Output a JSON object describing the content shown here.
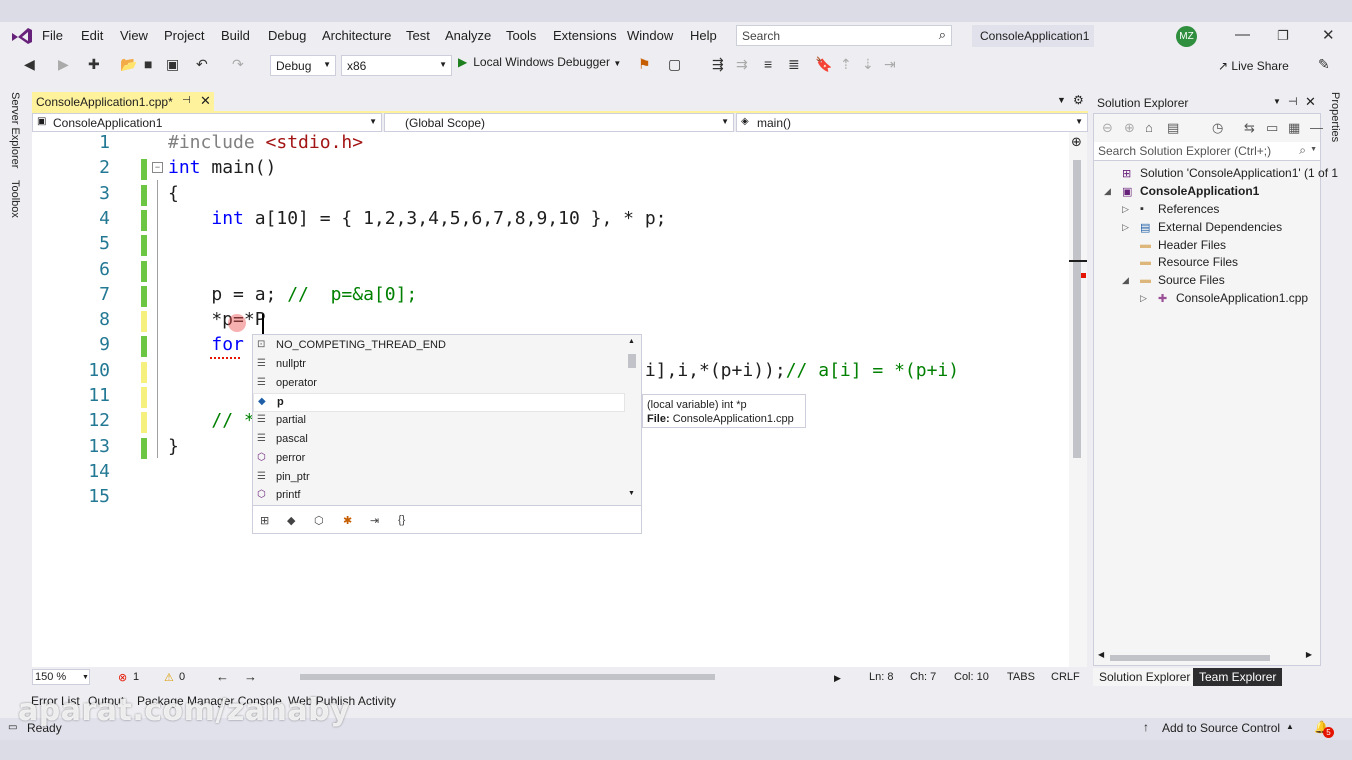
{
  "menu": {
    "items": [
      "File",
      "Edit",
      "View",
      "Project",
      "Build",
      "Debug",
      "Architecture",
      "Test",
      "Analyze",
      "Tools",
      "Extensions",
      "Window",
      "Help"
    ],
    "search_placeholder": "Search",
    "solution_name": "ConsoleApplication1",
    "avatar_initials": "MZ"
  },
  "toolbar": {
    "configuration": "Debug",
    "platform": "x86",
    "run_label": "Local Windows Debugger",
    "live_share": "Live Share"
  },
  "left_strip": {
    "server_explorer": "Server Explorer",
    "toolbox": "Toolbox"
  },
  "right_strip": {
    "properties": "Properties"
  },
  "document_tab": {
    "title": "ConsoleApplication1.cpp*"
  },
  "navbar": {
    "project": "ConsoleApplication1",
    "scope": "(Global Scope)",
    "member": "main()"
  },
  "editor": {
    "zoom": "150 %",
    "errors": "1",
    "warnings": "0",
    "line_col": "Ln: 8",
    "ch": "Ch: 7",
    "col": "Col: 10",
    "tabs": "TABS",
    "eol": "CRLF",
    "lines": [
      {
        "n": "1",
        "tokens": [
          {
            "t": "#include ",
            "c": "pp"
          },
          {
            "t": "<stdio.h>",
            "c": "str"
          }
        ]
      },
      {
        "n": "2",
        "tokens": [
          {
            "t": "int",
            "c": "kw"
          },
          {
            "t": " main()",
            "c": ""
          }
        ]
      },
      {
        "n": "3",
        "tokens": [
          {
            "t": "{",
            "c": ""
          }
        ]
      },
      {
        "n": "4",
        "tokens": [
          {
            "t": "    ",
            "c": ""
          },
          {
            "t": "int",
            "c": "kw"
          },
          {
            "t": " a[10] = { 1,2,3,4,5,6,7,8,9,10 }, * p;",
            "c": ""
          }
        ]
      },
      {
        "n": "5",
        "tokens": []
      },
      {
        "n": "6",
        "tokens": []
      },
      {
        "n": "7",
        "tokens": [
          {
            "t": "    p = a; ",
            "c": ""
          },
          {
            "t": "//  p=&a[0];",
            "c": "cmt"
          }
        ]
      },
      {
        "n": "8",
        "tokens": [
          {
            "t": "    *p=*P",
            "c": ""
          }
        ]
      },
      {
        "n": "9",
        "tokens": [
          {
            "t": "    ",
            "c": ""
          },
          {
            "t": "for",
            "c": "kw"
          }
        ]
      },
      {
        "n": "10",
        "tokens": [
          {
            "t": "                                       ,i,a[i],i,*(p+i));",
            "c": ""
          },
          {
            "t": "// a[i] = *(p+i)",
            "c": "cmt"
          }
        ]
      },
      {
        "n": "11",
        "tokens": []
      },
      {
        "n": "12",
        "tokens": [
          {
            "t": "    ",
            "c": ""
          },
          {
            "t": "// *",
            "c": "cmt"
          }
        ]
      },
      {
        "n": "13",
        "tokens": [
          {
            "t": "}",
            "c": ""
          }
        ]
      },
      {
        "n": "14",
        "tokens": []
      },
      {
        "n": "15",
        "tokens": []
      }
    ]
  },
  "intellisense": {
    "items": [
      {
        "label": "NO_COMPETING_THREAD_END",
        "icon": "macro-icon"
      },
      {
        "label": "nullptr",
        "icon": "keyword-icon"
      },
      {
        "label": "operator",
        "icon": "keyword-icon"
      },
      {
        "label": "p",
        "icon": "variable-icon",
        "selected": true
      },
      {
        "label": "partial",
        "icon": "keyword-icon"
      },
      {
        "label": "pascal",
        "icon": "keyword-icon"
      },
      {
        "label": "perror",
        "icon": "function-icon"
      },
      {
        "label": "pin_ptr",
        "icon": "keyword-icon"
      },
      {
        "label": "printf",
        "icon": "function-icon"
      }
    ],
    "tooltip_line1": "(local variable) int *p",
    "tooltip_line2_label": "File:",
    "tooltip_line2_value": "ConsoleApplication1.cpp"
  },
  "solution_explorer": {
    "title": "Solution Explorer",
    "search_placeholder": "Search Solution Explorer (Ctrl+;)",
    "nodes": [
      {
        "label": "Solution 'ConsoleApplication1' (1 of 1",
        "icon": "solution-icon"
      },
      {
        "label": "ConsoleApplication1",
        "icon": "project-icon",
        "bold": true
      },
      {
        "label": "References",
        "icon": "references-icon"
      },
      {
        "label": "External Dependencies",
        "icon": "dependencies-icon"
      },
      {
        "label": "Header Files",
        "icon": "folder-icon"
      },
      {
        "label": "Resource Files",
        "icon": "folder-icon"
      },
      {
        "label": "Source Files",
        "icon": "folder-icon"
      },
      {
        "label": "ConsoleApplication1.cpp",
        "icon": "cpp-file-icon"
      }
    ],
    "tabs": [
      "Solution Explorer",
      "Team Explorer"
    ]
  },
  "bottom_tabs": [
    "Error List",
    "Output",
    "Package Manager Console",
    "Web Publish Activity"
  ],
  "status": {
    "ready": "Ready",
    "source_control": "Add to Source Control",
    "notifications": "5"
  },
  "watermark": "aparat.com/zanaby",
  "colors": {
    "accent": "#68217a",
    "tab_yellow": "#fff29d",
    "keyword": "#0000ff",
    "comment": "#008000",
    "line_number": "#237893"
  }
}
